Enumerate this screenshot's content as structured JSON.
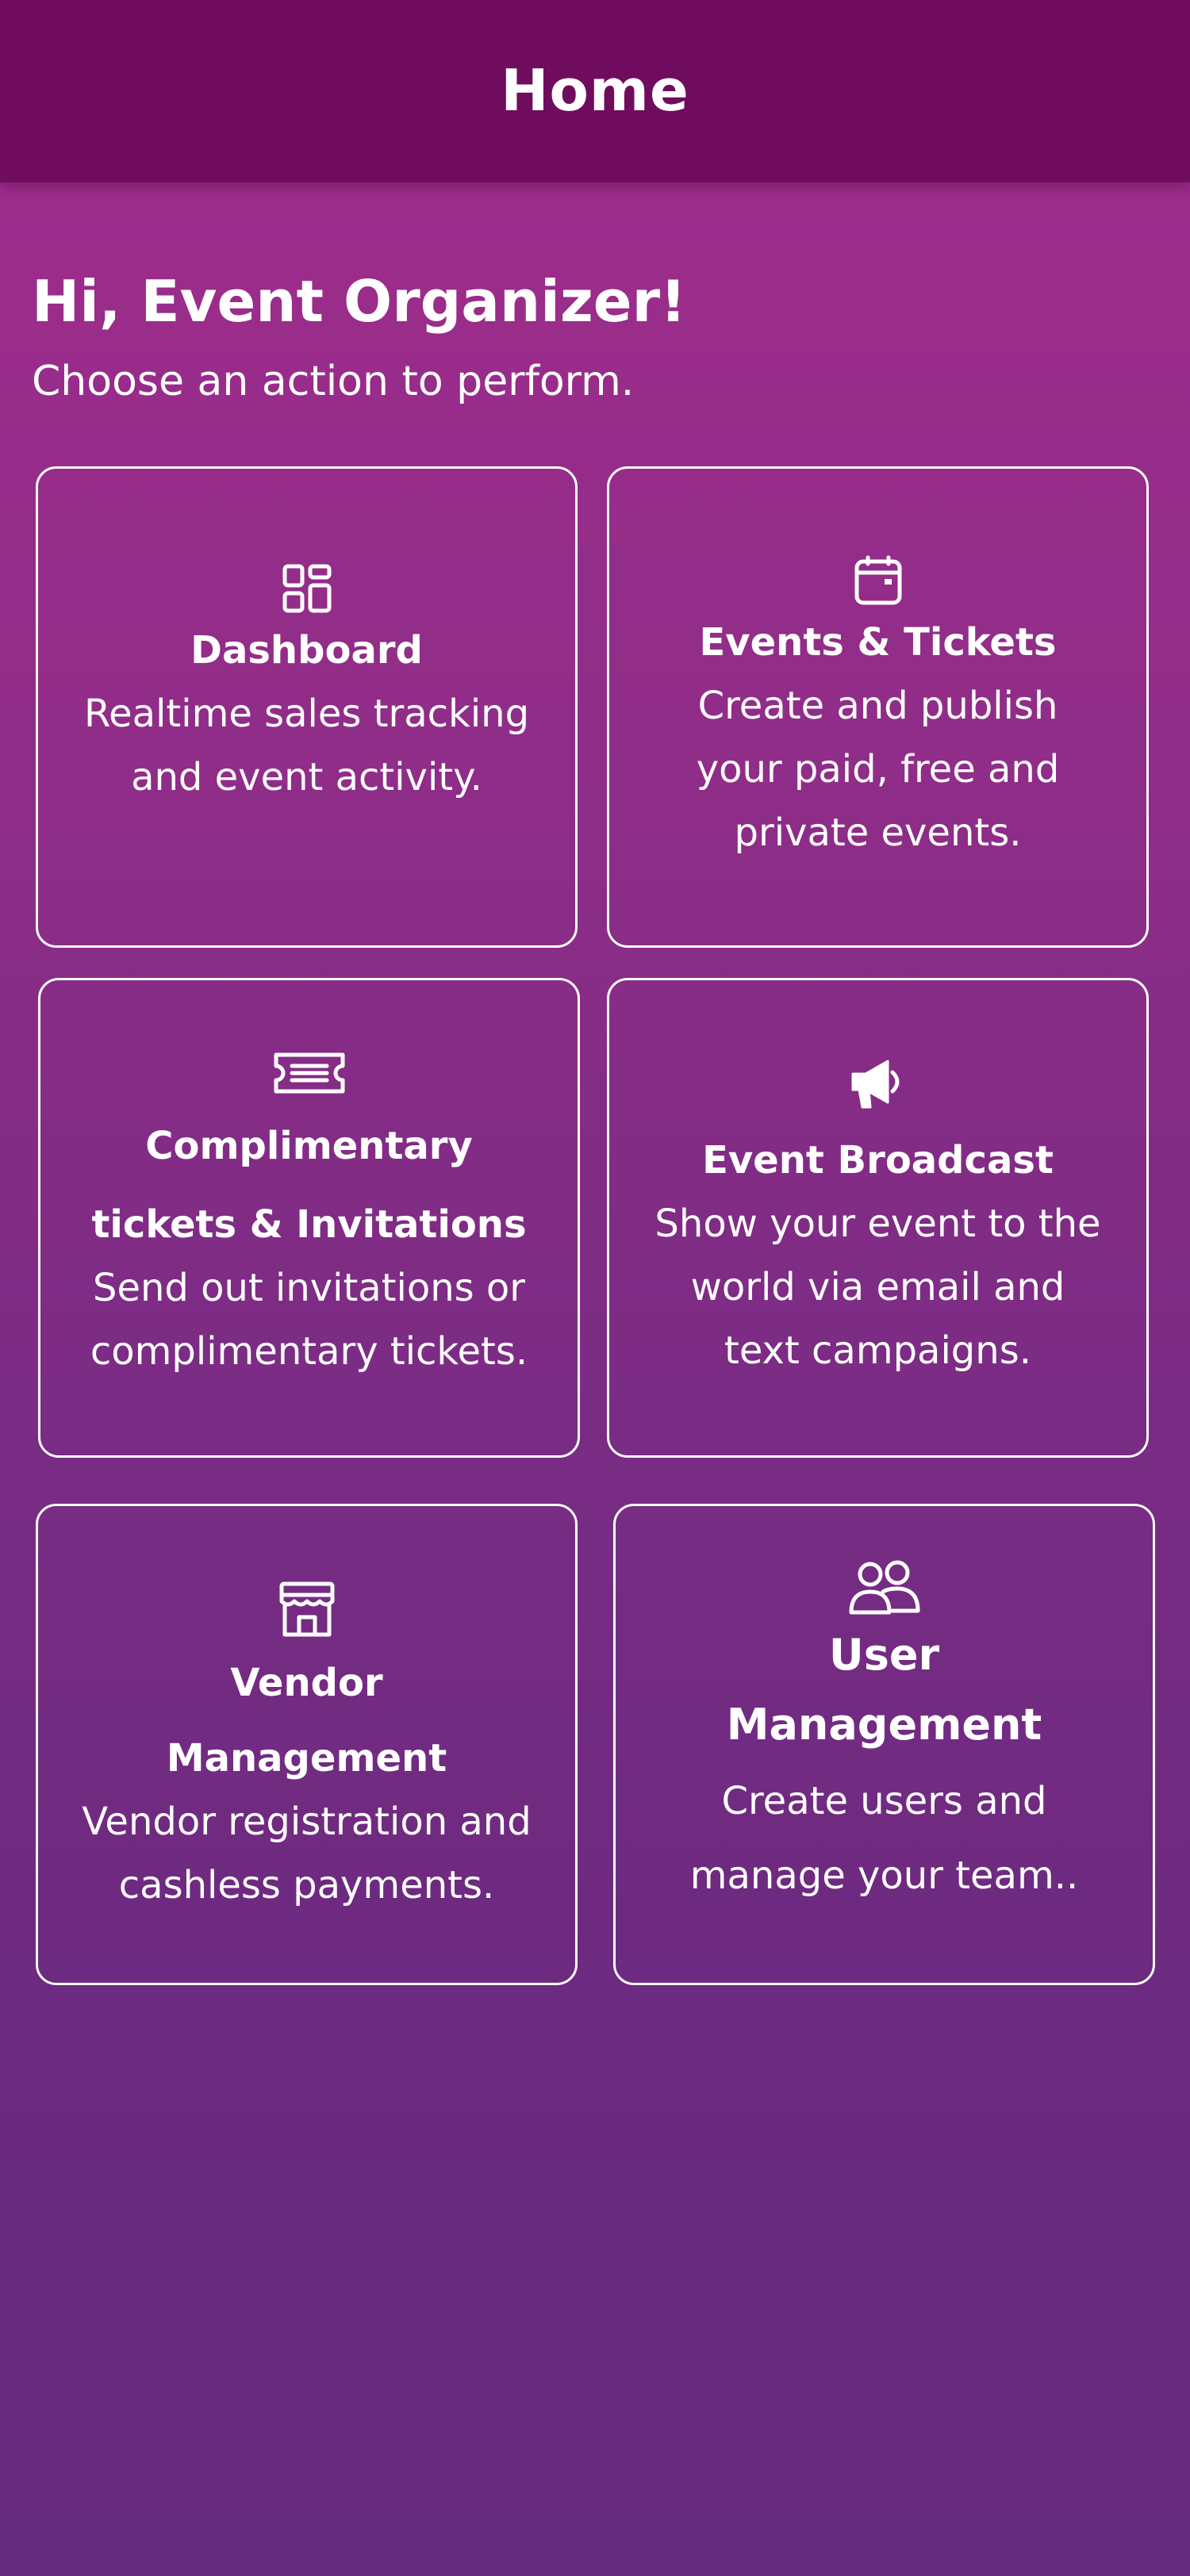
{
  "header": {
    "title": "Home",
    "background": "#700c5e"
  },
  "greeting": {
    "title": "Hi, Event Organizer!",
    "subtitle": "Choose an action to perform."
  },
  "cards": [
    {
      "icon": "dashboard-icon",
      "title_lines": [
        "Dashboard"
      ],
      "desc_lines": [
        "Realtime sales tracking",
        "and event activity."
      ]
    },
    {
      "icon": "calendar-icon",
      "title_lines": [
        "Events & Tickets"
      ],
      "desc_lines": [
        "Create and publish",
        "your paid, free and",
        "private events."
      ]
    },
    {
      "icon": "ticket-icon",
      "title_lines": [
        "Complimentary",
        "tickets & Invitations"
      ],
      "desc_lines": [
        "Send out invitations or",
        "complimentary tickets."
      ]
    },
    {
      "icon": "megaphone-icon",
      "title_lines": [
        "Event Broadcast"
      ],
      "desc_lines": [
        "Show your event to the",
        "world via email and",
        "text campaigns."
      ]
    },
    {
      "icon": "store-icon",
      "title_lines": [
        "Vendor",
        "Management"
      ],
      "desc_lines": [
        "Vendor registration and",
        "cashless payments."
      ]
    },
    {
      "icon": "users-icon",
      "title_lines": [
        "User",
        "Management"
      ],
      "desc_lines": [
        "Create users and",
        "manage your team.."
      ]
    }
  ],
  "colors": {
    "gradient_top": "#a22c8c",
    "gradient_bottom": "#642a7c",
    "text": "#ffffff"
  }
}
